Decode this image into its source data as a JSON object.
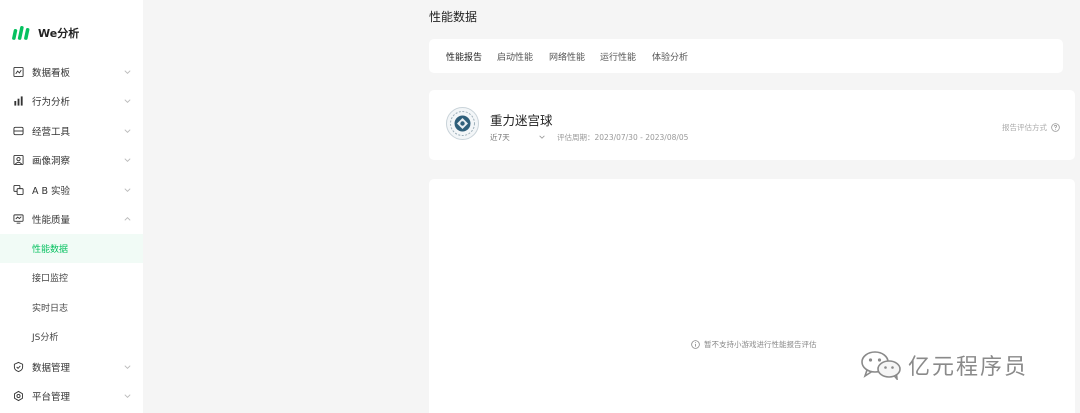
{
  "app": {
    "name": "We分析",
    "brand_color": "#07c160"
  },
  "sidebar": {
    "items": [
      {
        "label": "数据看板",
        "icon": "dashboard-icon",
        "expanded": false
      },
      {
        "label": "行为分析",
        "icon": "bar-chart-icon",
        "expanded": false
      },
      {
        "label": "经营工具",
        "icon": "toolbox-icon",
        "expanded": false
      },
      {
        "label": "画像洞察",
        "icon": "portrait-icon",
        "expanded": false
      },
      {
        "label": "A B 实验",
        "icon": "ab-test-icon",
        "expanded": false
      },
      {
        "label": "性能质量",
        "icon": "monitor-icon",
        "expanded": true
      }
    ],
    "sub_items": [
      {
        "label": "性能数据",
        "active": true
      },
      {
        "label": "接口监控",
        "active": false
      },
      {
        "label": "实时日志",
        "active": false
      },
      {
        "label": "JS分析",
        "active": false
      }
    ],
    "bottom_items": [
      {
        "label": "数据管理",
        "icon": "shield-icon",
        "expanded": false
      },
      {
        "label": "平台管理",
        "icon": "settings-icon",
        "expanded": false
      }
    ]
  },
  "main": {
    "title": "性能数据",
    "tabs": [
      {
        "label": "性能报告",
        "active": true
      },
      {
        "label": "启动性能",
        "active": false
      },
      {
        "label": "网络性能",
        "active": false
      },
      {
        "label": "运行性能",
        "active": false
      },
      {
        "label": "体验分析",
        "active": false
      }
    ],
    "game": {
      "name": "重力迷宫球",
      "period": "近7天",
      "eval_period": "评估周期：2023/07/30 - 2023/08/05",
      "report_method": "报告评估方式"
    },
    "empty_message": "暂不支持小游戏进行性能报告评估"
  },
  "watermark": {
    "text": "亿元程序员"
  }
}
